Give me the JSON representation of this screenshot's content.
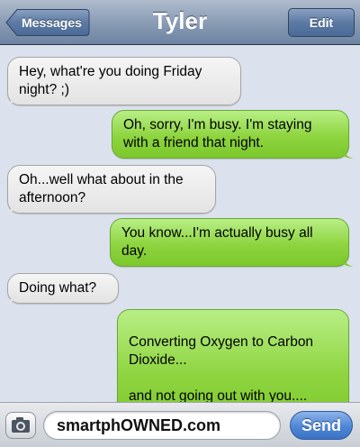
{
  "navbar": {
    "back_label": "Messages",
    "title": "Tyler",
    "edit_label": "Edit"
  },
  "messages": [
    {
      "direction": "incoming",
      "text": "Hey, what're you doing Friday night? ;)"
    },
    {
      "direction": "outgoing",
      "text": "Oh, sorry, I'm busy. I'm staying with a friend that night."
    },
    {
      "direction": "incoming",
      "text": "Oh...well what about in the afternoon?"
    },
    {
      "direction": "outgoing",
      "text": "You know...I'm actually busy all day."
    },
    {
      "direction": "incoming",
      "text": "Doing what?"
    },
    {
      "direction": "outgoing",
      "text": "Converting Oxygen to Carbon Dioxide...\n\nand not going out with you...."
    }
  ],
  "composer": {
    "value": "smartphOWNED.com",
    "send_label": "Send",
    "camera_icon": "camera-icon"
  },
  "colors": {
    "incoming_bubble": "#e8e8e8",
    "outgoing_bubble": "#8ed43f",
    "navbar": "#8b9cb5",
    "send_button": "#4f86d6"
  }
}
